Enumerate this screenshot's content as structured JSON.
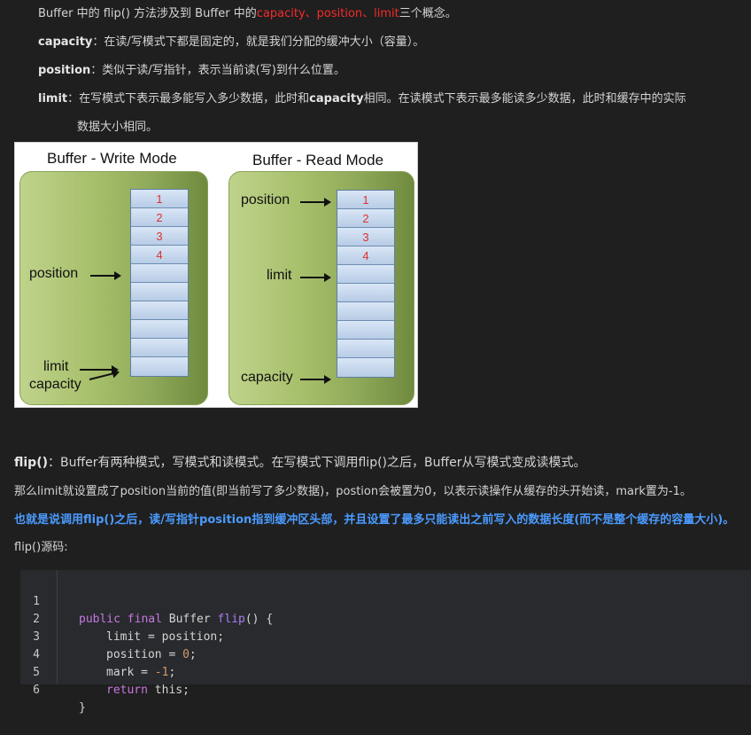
{
  "intro": {
    "prefix": "Buffer 中的 flip() 方法涉及到 Buffer 中的",
    "highlight": "capacity、position、limit",
    "suffix": "三个概念。"
  },
  "defs": [
    {
      "term": "capacity",
      "text": "：在读/写模式下都是固定的，就是我们分配的缓冲大小（容量）。"
    },
    {
      "term": "position",
      "text": "：类似于读/写指针，表示当前读(写)到什么位置。"
    },
    {
      "term": "limit",
      "text": "：在写模式下表示最多能写入多少数据，此时和",
      "term2": "capacity",
      "text2": "相同。在读模式下表示最多能读多少数据，此时和缓存中的实际"
    }
  ],
  "limit_cont": "数据大小相同。",
  "diagram": {
    "write_title": "Buffer - Write Mode",
    "read_title": "Buffer - Read Mode",
    "write_labels": {
      "position": "position",
      "limit": "limit",
      "capacity": "capacity"
    },
    "read_labels": {
      "position": "position",
      "limit": "limit",
      "capacity": "capacity"
    },
    "cell_numbers": [
      "1",
      "2",
      "3",
      "4"
    ]
  },
  "flip_heading": {
    "term": "flip()",
    "text": "：Buffer有两种模式，写模式和读模式。在写模式下调用flip()之后，Buffer从写模式变成读模式。"
  },
  "flip_detail": "那么limit就设置成了position当前的值(即当前写了多少数据)，postion会被置为0，以表示读操作从缓存的头开始读，mark置为-1。",
  "flip_summary": "也就是说调用flip()之后，读/写指针position指到缓冲区头部，并且设置了最多只能读出之前写入的数据长度(而不是整个缓存的容量大小)。",
  "source_label": "flip()源码:",
  "code": {
    "line_numbers": [
      "1",
      "2",
      "3",
      "4",
      "5",
      "6"
    ],
    "line1": {
      "kw": "public final",
      "type": " Buffer ",
      "fn": "flip",
      "rest": "() {"
    },
    "line2": "limit = position;",
    "line3": {
      "pre": "position = ",
      "num": "0",
      "post": ";"
    },
    "line4": {
      "pre": "mark = ",
      "num": "-1",
      "post": ";"
    },
    "line5": {
      "kw": "return",
      "rest": " this;"
    },
    "line6": "}"
  }
}
